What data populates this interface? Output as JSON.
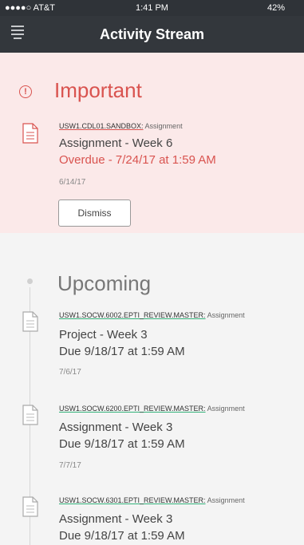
{
  "status_bar": {
    "carrier": "●●●●○ AT&T",
    "time": "1:41 PM",
    "battery": "42%"
  },
  "header": {
    "title": "Activity Stream"
  },
  "important": {
    "title": "Important",
    "items": [
      {
        "course_code": "USW1.CDL01.SANDBOX:",
        "type": "Assignment",
        "title": "Assignment - Week 6",
        "due_prefix": "Overdue",
        "due_rest": " - 7/24/17 at 1:59 AM",
        "date": "6/14/17",
        "dismiss_label": "Dismiss"
      }
    ]
  },
  "upcoming": {
    "title": "Upcoming",
    "items": [
      {
        "course_code": "USW1.SOCW.6002.EPTI_REVIEW.MASTER:",
        "type": "Assignment",
        "title": "Project - Week 3",
        "due": "Due 9/18/17 at 1:59 AM",
        "date": "7/6/17"
      },
      {
        "course_code": "USW1.SOCW.6200.EPTI_REVIEW.MASTER:",
        "type": "Assignment",
        "title": "Assignment - Week 3",
        "due": "Due 9/18/17 at 1:59 AM",
        "date": "7/7/17"
      },
      {
        "course_code": "USW1.SOCW.6301.EPTI_REVIEW.MASTER:",
        "type": "Assignment",
        "title": "Assignment - Week 3",
        "due": "Due 9/18/17 at 1:59 AM"
      }
    ]
  },
  "colors": {
    "accent_red": "#d9534f",
    "important_bg": "#fbe9e9",
    "header_bg": "#33373c",
    "course_underline_upcoming": "#33b27a"
  }
}
